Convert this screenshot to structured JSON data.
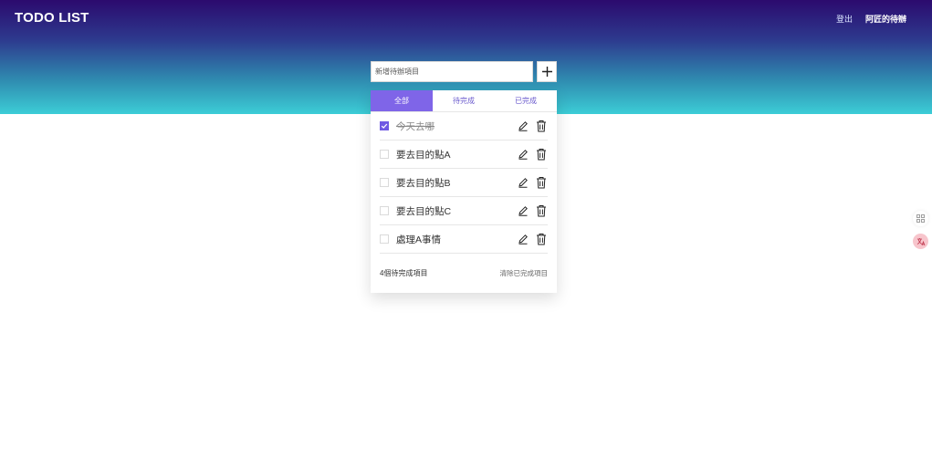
{
  "header": {
    "brand": "TODO LIST",
    "logout_label": "登出",
    "user_label": "阿匠的待辦"
  },
  "add": {
    "placeholder": "新增待辦項目",
    "button_icon": "plus-icon"
  },
  "tabs": [
    {
      "label": "全部",
      "active": true
    },
    {
      "label": "待完成",
      "active": false
    },
    {
      "label": "已完成",
      "active": false
    }
  ],
  "todos": [
    {
      "text": "今天去哪",
      "done": true
    },
    {
      "text": "要去目的點A",
      "done": false
    },
    {
      "text": "要去目的點B",
      "done": false
    },
    {
      "text": "要去目的點C",
      "done": false
    },
    {
      "text": "處理A事情",
      "done": false
    }
  ],
  "footer": {
    "remaining": "4個待完成項目",
    "clear_label": "清除已完成項目"
  },
  "colors": {
    "accent": "#7f65e8",
    "header_top": "#2c0a6e",
    "header_bottom": "#3ccdd6"
  }
}
